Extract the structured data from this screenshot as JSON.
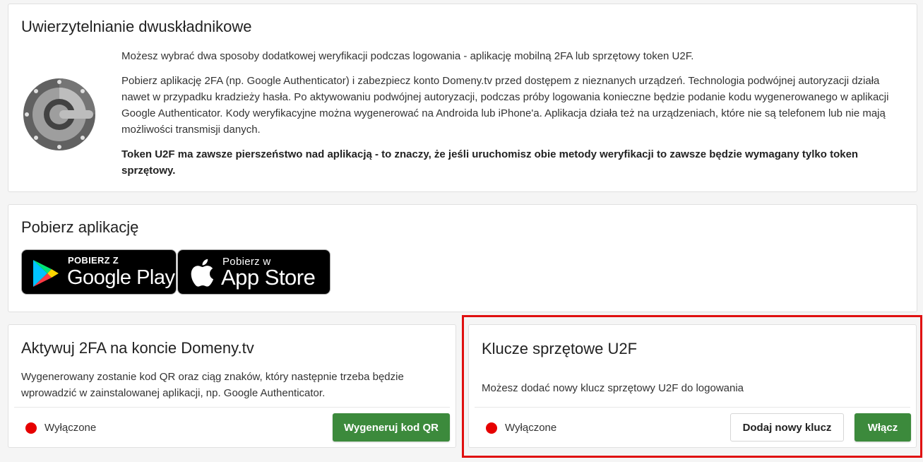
{
  "twofa_info": {
    "title": "Uwierzytelnianie dwuskładnikowe",
    "logo_icon": "google-authenticator-icon",
    "paragraphs": [
      "Możesz wybrać dwa sposoby dodatkowej weryfikacji podczas logowania - aplikację mobilną 2FA lub sprzętowy token U2F.",
      "Pobierz aplikację 2FA (np. Google Authenticator) i zabezpiecz konto Domeny.tv przed dostępem z nieznanych urządzeń. Technologia podwójnej autoryzacji działa nawet w przypadku kradzieży hasła. Po aktywowaniu podwójnej autoryzacji, podczas próby logowania konieczne będzie podanie kodu wygenerowanego w aplikacji Google Authenticator. Kody weryfikacyjne można wygenerować na Androida lub iPhone'a. Aplikacja działa też na urządzeniach, które nie są telefonem lub nie mają możliwości transmisji danych."
    ],
    "bold_note": "Token U2F ma zawsze pierszeństwo nad aplikacją - to znaczy, że jeśli uruchomisz obie metody weryfikacji to zawsze będzie wymagany tylko token sprzętowy."
  },
  "download": {
    "title": "Pobierz aplikację",
    "google_play": {
      "small": "POBIERZ Z",
      "big": "Google Play",
      "icon": "google-play-icon"
    },
    "app_store": {
      "small": "Pobierz w",
      "big": "App Store",
      "icon": "apple-icon"
    }
  },
  "activate_2fa": {
    "title": "Aktywuj 2FA na koncie Domeny.tv",
    "description": "Wygenerowany zostanie kod QR oraz ciąg znaków, który następnie trzeba będzie wprowadzić w zainstalowanej aplikacji, np. Google Authenticator.",
    "status": "Wyłączone",
    "button": "Wygeneruj kod QR"
  },
  "u2f_keys": {
    "title": "Klucze sprzętowe U2F",
    "description": "Możesz dodać nowy klucz sprzętowy U2F do logowania",
    "status": "Wyłączone",
    "add_button": "Dodaj nowy klucz",
    "enable_button": "Włącz"
  },
  "colors": {
    "accent_green": "#3c8a3c",
    "status_off": "#e60000",
    "highlight_red": "#e01010"
  }
}
